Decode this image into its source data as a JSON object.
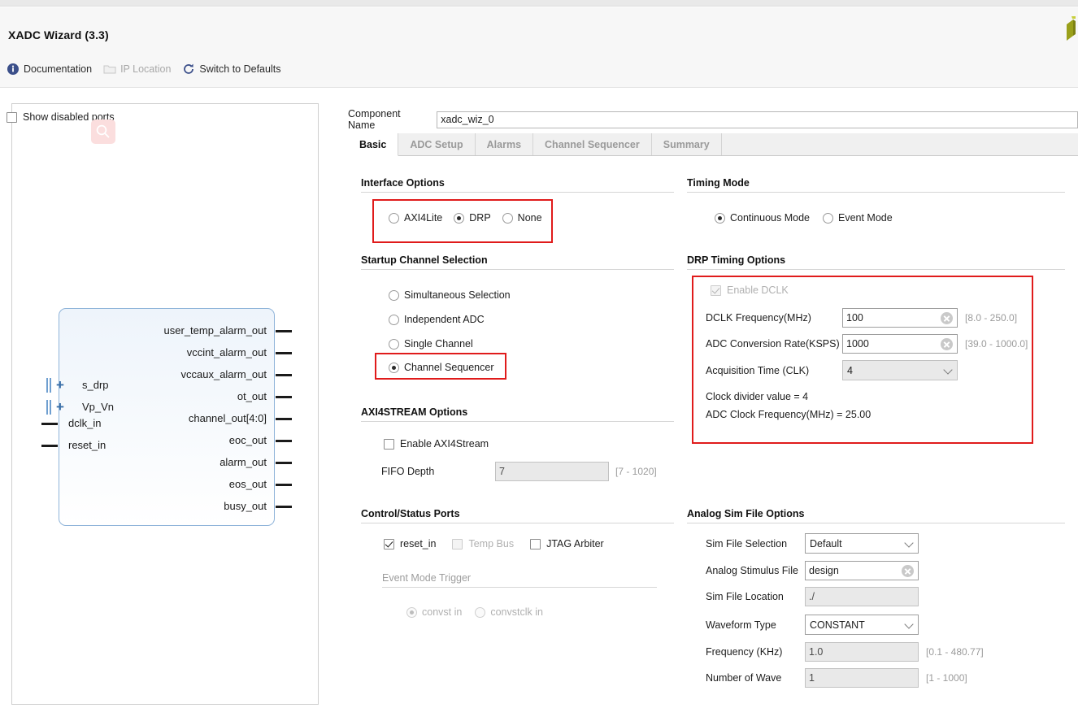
{
  "window": {
    "title": "XADC Wizard (3.3)"
  },
  "toolbar": {
    "documentation": "Documentation",
    "ip_location": "IP Location",
    "switch_defaults": "Switch to Defaults"
  },
  "left_panel": {
    "show_disabled_ports_label": "Show disabled ports",
    "show_disabled_ports_checked": false,
    "diagram": {
      "inputs": [
        {
          "name": "s_drp",
          "type": "bus"
        },
        {
          "name": "Vp_Vn",
          "type": "bus"
        },
        {
          "name": "dclk_in",
          "type": "pin"
        },
        {
          "name": "reset_in",
          "type": "pin"
        }
      ],
      "outputs": [
        "user_temp_alarm_out",
        "vccint_alarm_out",
        "vccaux_alarm_out",
        "ot_out",
        "channel_out[4:0]",
        "eoc_out",
        "alarm_out",
        "eos_out",
        "busy_out"
      ]
    }
  },
  "component": {
    "label": "Component Name",
    "value": "xadc_wiz_0"
  },
  "tabs": [
    {
      "label": "Basic",
      "active": true
    },
    {
      "label": "ADC Setup",
      "active": false
    },
    {
      "label": "Alarms",
      "active": false
    },
    {
      "label": "Channel Sequencer",
      "active": false
    },
    {
      "label": "Summary",
      "active": false
    }
  ],
  "interface_options": {
    "title": "Interface Options",
    "highlighted": true,
    "options": [
      {
        "label": "AXI4Lite",
        "selected": false
      },
      {
        "label": "DRP",
        "selected": true
      },
      {
        "label": "None",
        "selected": false
      }
    ]
  },
  "startup_channel_selection": {
    "title": "Startup Channel Selection",
    "options": [
      {
        "label": "Simultaneous Selection",
        "selected": false,
        "highlighted": false
      },
      {
        "label": "Independent ADC",
        "selected": false,
        "highlighted": false
      },
      {
        "label": "Single Channel",
        "selected": false,
        "highlighted": false
      },
      {
        "label": "Channel Sequencer",
        "selected": true,
        "highlighted": true
      }
    ]
  },
  "axi4stream_options": {
    "title": "AXI4STREAM Options",
    "enable_label": "Enable AXI4Stream",
    "enable_checked": false,
    "fifo_depth_label": "FIFO Depth",
    "fifo_depth_value": "7",
    "fifo_depth_range": "[7 - 1020]",
    "fifo_depth_disabled": true
  },
  "control_status_ports": {
    "title": "Control/Status Ports",
    "checkboxes": [
      {
        "label": "reset_in",
        "checked": true,
        "disabled": false
      },
      {
        "label": "Temp Bus",
        "checked": false,
        "disabled": true
      },
      {
        "label": "JTAG Arbiter",
        "checked": false,
        "disabled": false
      }
    ],
    "event_mode_trigger_title": "Event Mode Trigger",
    "event_mode_options": [
      {
        "label": "convst in",
        "selected": true,
        "disabled": true
      },
      {
        "label": "convstclk in",
        "selected": false,
        "disabled": true
      }
    ]
  },
  "timing_mode": {
    "title": "Timing Mode",
    "options": [
      {
        "label": "Continuous Mode",
        "selected": true
      },
      {
        "label": "Event Mode",
        "selected": false
      }
    ]
  },
  "drp_timing_options": {
    "title": "DRP Timing Options",
    "highlighted": true,
    "enable_dclk_label": "Enable DCLK",
    "enable_dclk_checked": true,
    "enable_dclk_disabled": true,
    "fields": [
      {
        "label": "DCLK Frequency(MHz)",
        "value": "100",
        "range": "[8.0 - 250.0]",
        "clearable": true,
        "disabled": false
      },
      {
        "label": "ADC Conversion Rate(KSPS)",
        "value": "1000",
        "range": "[39.0 - 1000.0]",
        "clearable": true,
        "disabled": false
      }
    ],
    "acquisition_time_label": "Acquisition Time (CLK)",
    "acquisition_time_value": "4",
    "acquisition_time_disabled": true,
    "clock_divider_text": "Clock divider value = 4",
    "adc_clock_freq_text": "ADC Clock Frequency(MHz) = 25.00"
  },
  "analog_sim_file_options": {
    "title": "Analog Sim File Options",
    "rows": [
      {
        "label": "Sim File Selection",
        "value": "Default",
        "kind": "select",
        "disabled": false,
        "range": ""
      },
      {
        "label": "Analog Stimulus File",
        "value": "design",
        "kind": "text",
        "disabled": false,
        "clearable": true,
        "range": ""
      },
      {
        "label": "Sim File Location",
        "value": "./",
        "kind": "text",
        "disabled": true,
        "range": ""
      },
      {
        "label": "Waveform Type",
        "value": "CONSTANT",
        "kind": "select",
        "disabled": false,
        "range": ""
      },
      {
        "label": "Frequency (KHz)",
        "value": "1.0",
        "kind": "text",
        "disabled": true,
        "range": "[0.1 - 480.77]"
      },
      {
        "label": "Number of Wave",
        "value": "1",
        "kind": "text",
        "disabled": true,
        "range": "[1 - 1000]"
      }
    ]
  },
  "colors": {
    "highlight_red": "#e01b1b",
    "accent_blue": "#3a6fa8",
    "logo_olive": "#9aa01a"
  }
}
